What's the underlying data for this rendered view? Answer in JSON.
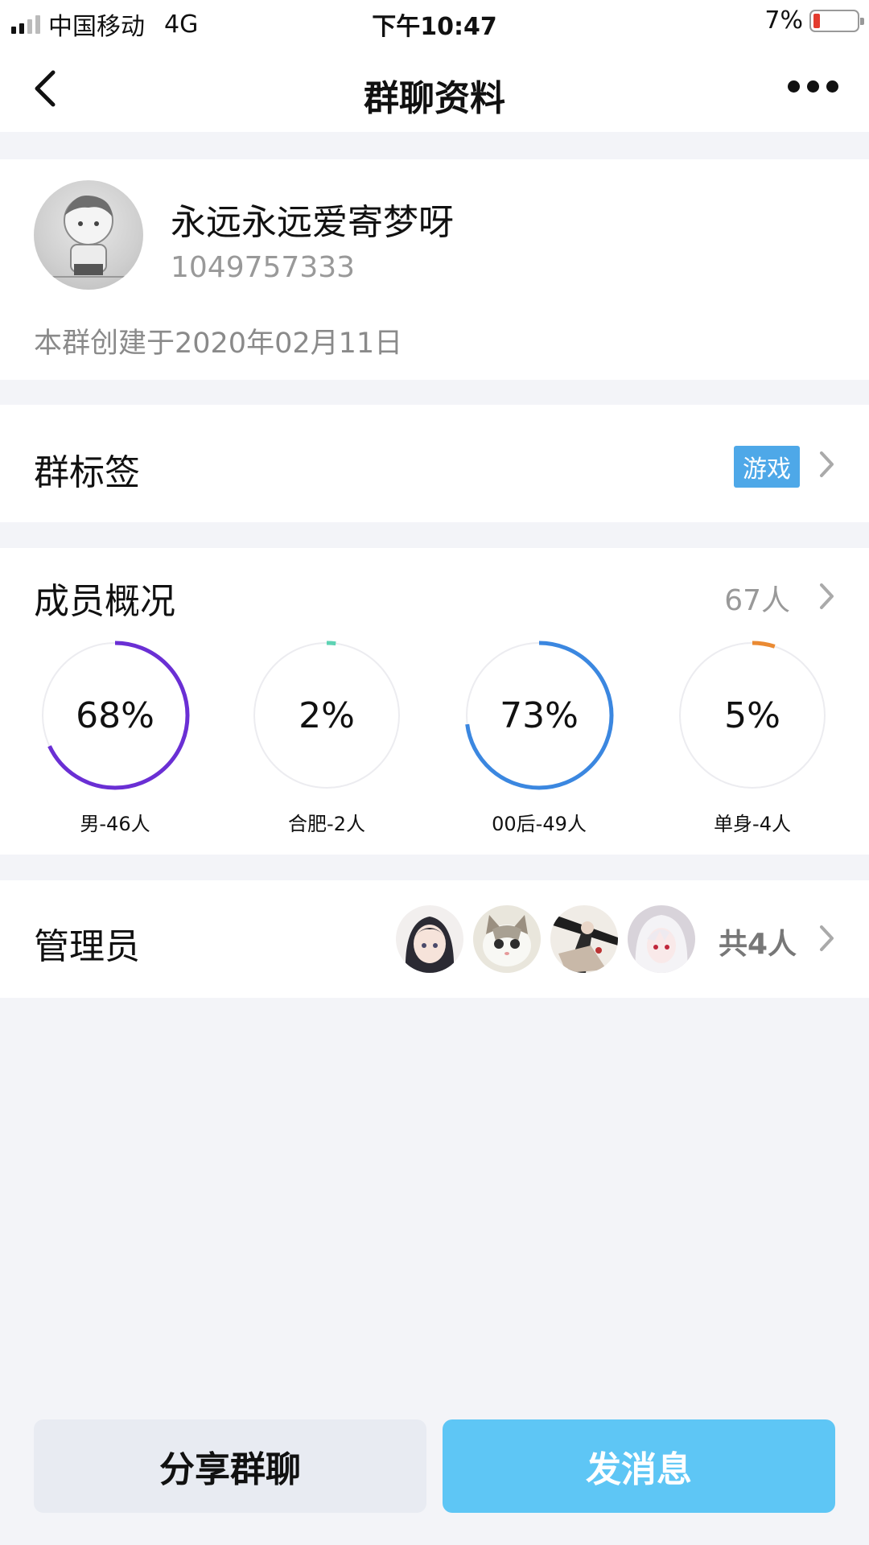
{
  "status_bar": {
    "carrier": "中国移动",
    "network": "4G",
    "time": "下午10:47",
    "battery_text": "7%",
    "battery_level": 0.07
  },
  "header": {
    "title": "群聊资料",
    "back_icon": "back-arrow-icon",
    "more_icon": "more-dots-icon"
  },
  "profile": {
    "name": "永远永远爱寄梦呀",
    "id": "1049757333",
    "created": "本群创建于2020年02月11日"
  },
  "tag_row": {
    "label": "群标签",
    "tag": "游戏",
    "tag_color": "#4ea8e8"
  },
  "members": {
    "label": "成员概况",
    "count": "67人",
    "stats": [
      {
        "percent_text": "68%",
        "percent": 68,
        "label": "男-46人",
        "color": "#6a2fd4"
      },
      {
        "percent_text": "2%",
        "percent": 2,
        "label": "合肥-2人",
        "color": "#5ed3b4"
      },
      {
        "percent_text": "73%",
        "percent": 73,
        "label": "00后-49人",
        "color": "#3b87e0"
      },
      {
        "percent_text": "5%",
        "percent": 5,
        "label": "单身-4人",
        "color": "#ea8a33"
      }
    ]
  },
  "admins": {
    "label": "管理员",
    "count": "共4人"
  },
  "buttons": {
    "share": "分享群聊",
    "send": "发消息",
    "send_color": "#5ec6f5"
  }
}
